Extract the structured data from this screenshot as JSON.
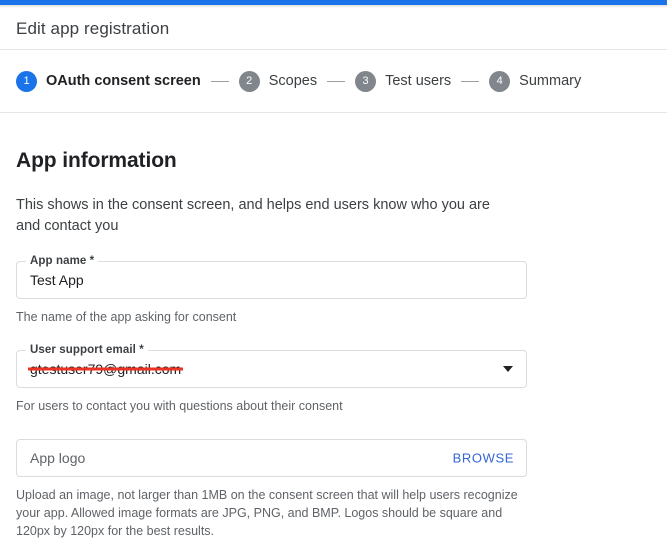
{
  "window": {
    "accent_color": "#1a73e8"
  },
  "header": {
    "title": "Edit app registration"
  },
  "stepper": {
    "steps": [
      {
        "number": "1",
        "label": "OAuth consent screen",
        "state": "active"
      },
      {
        "number": "2",
        "label": "Scopes",
        "state": "inactive"
      },
      {
        "number": "3",
        "label": "Test users",
        "state": "inactive"
      },
      {
        "number": "4",
        "label": "Summary",
        "state": "inactive"
      }
    ]
  },
  "main": {
    "section_title": "App information",
    "section_description": "This shows in the consent screen, and helps end users know who you are and contact you",
    "fields": {
      "app_name": {
        "label": "App name *",
        "value": "Test App",
        "helper": "The name of the app asking for consent"
      },
      "user_support_email": {
        "label": "User support email *",
        "value": "gtestuser79@gmail.com",
        "helper": "For users to contact you with questions about their consent",
        "redacted": true
      },
      "app_logo": {
        "placeholder": "App logo",
        "browse_label": "BROWSE",
        "helper": "Upload an image, not larger than 1MB on the consent screen that will help users recognize your app. Allowed image formats are JPG, PNG, and BMP. Logos should be square and 120px by 120px for the best results."
      }
    }
  }
}
